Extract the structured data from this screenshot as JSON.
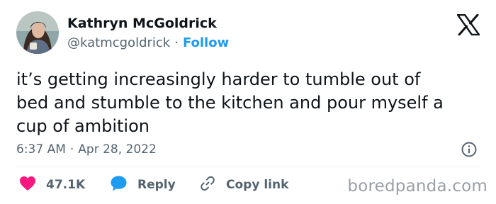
{
  "author": {
    "name": "Kathryn McGoldrick",
    "handle": "@katmcgoldrick",
    "separator": "·",
    "follow_label": "Follow"
  },
  "tweet": {
    "text": "it’s getting increasingly harder to tumble out of\nbed and stumble to the kitchen and pour myself a\ncup of ambition",
    "time": "6:37 AM",
    "separator": "·",
    "date": "Apr 28, 2022"
  },
  "actions": {
    "like_count": "47.1K",
    "reply_label": "Reply",
    "copy_label": "Copy link"
  },
  "watermark": "boredpanda.com",
  "icons": {
    "brand": "x-logo-icon",
    "info": "info-icon",
    "like": "heart-icon",
    "reply": "speech-bubble-icon",
    "copy": "link-icon"
  },
  "colors": {
    "like": "#f91880",
    "reply": "#1d9bf0",
    "follow": "#1d9bf0",
    "text": "#0f1419",
    "muted": "#536471"
  }
}
